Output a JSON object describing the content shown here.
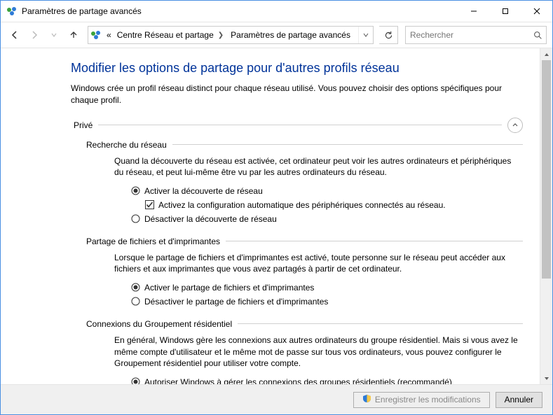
{
  "window": {
    "title": "Paramètres de partage avancés"
  },
  "nav": {
    "breadcrumb_prefix": "«",
    "crumb1": "Centre Réseau et partage",
    "crumb2": "Paramètres de partage avancés"
  },
  "search": {
    "placeholder": "Rechercher"
  },
  "page": {
    "title": "Modifier les options de partage pour d'autres profils réseau",
    "description": "Windows crée un profil réseau distinct pour chaque réseau utilisé. Vous pouvez choisir des options spécifiques pour chaque profil."
  },
  "profiles": {
    "prive": {
      "label": "Privé",
      "sections": {
        "discovery": {
          "title": "Recherche du réseau",
          "desc": "Quand la découverte du réseau est activée, cet ordinateur peut voir les autres ordinateurs et périphériques du réseau, et peut lui-même être vu par les autres ordinateurs du réseau.",
          "opt_enable": "Activer la découverte de réseau",
          "opt_auto": "Activez la configuration automatique des périphériques connectés au réseau.",
          "opt_disable": "Désactiver la découverte de réseau",
          "selected": "enable",
          "auto_checked": true
        },
        "fileshare": {
          "title": "Partage de fichiers et d'imprimantes",
          "desc": "Lorsque le partage de fichiers et d'imprimantes est activé, toute personne sur le réseau peut accéder aux fichiers et aux imprimantes que vous avez partagés à partir de cet ordinateur.",
          "opt_enable": "Activer le partage de fichiers et d'imprimantes",
          "opt_disable": "Désactiver le partage de fichiers et d'imprimantes",
          "selected": "enable"
        },
        "homegroup": {
          "title": "Connexions du Groupement résidentiel",
          "desc": "En général, Windows gère les connexions aux autres ordinateurs du groupe résidentiel. Mais si vous avez le même compte d'utilisateur et le même mot de passe sur tous vos ordinateurs, vous pouvez configurer le Groupement résidentiel pour utiliser votre compte.",
          "opt_windows": "Autoriser Windows à gérer les connexions des groupes résidentiels (recommandé)",
          "selected": "windows"
        }
      }
    }
  },
  "footer": {
    "save": "Enregistrer les modifications",
    "cancel": "Annuler",
    "save_enabled": false
  }
}
